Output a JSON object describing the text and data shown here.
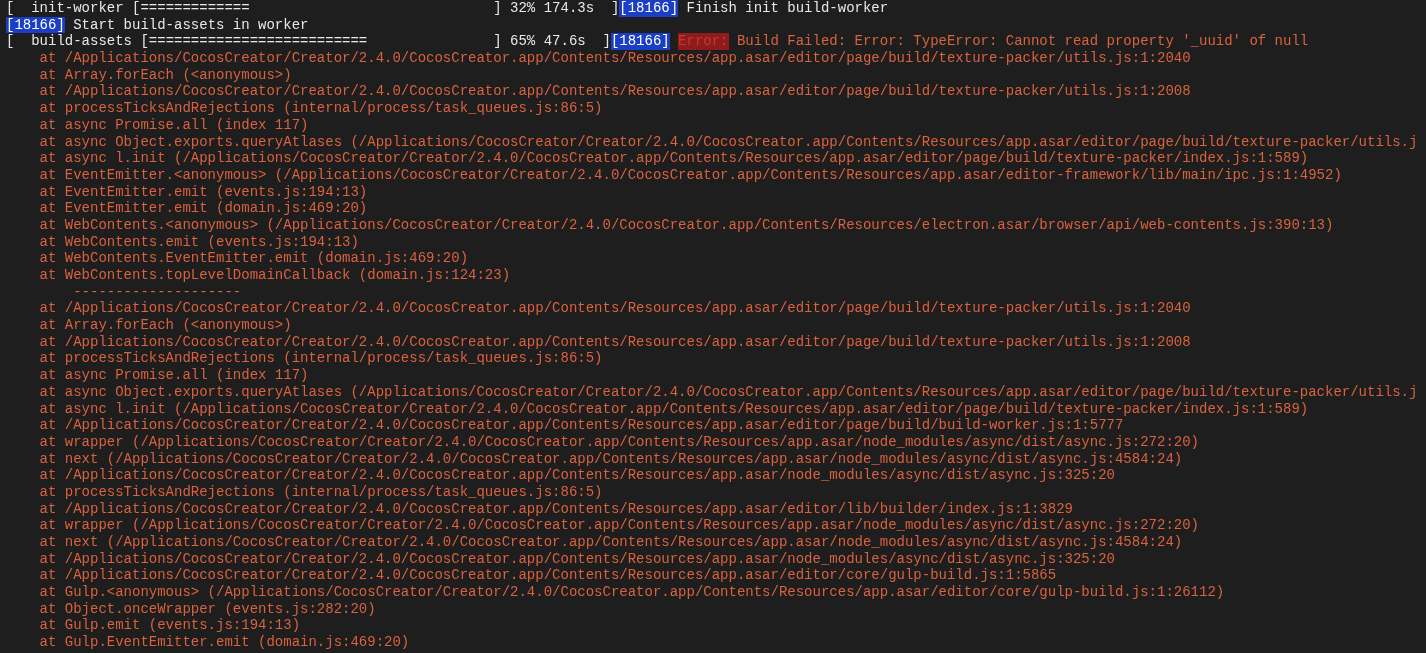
{
  "lines": [
    {
      "kind": "progress",
      "task": "[  init-worker [=============",
      "stats": "] 32% 174.3s  ]",
      "pid": "[18166]",
      "message": "Finish init build-worker"
    },
    {
      "kind": "info",
      "pid": "[18166]",
      "message": "Start build-assets in worker"
    },
    {
      "kind": "progress",
      "task": "[  build-assets [==========================",
      "stats": "] 65% 47.6s  ]",
      "pid": "[18166]",
      "tag": "Error:",
      "message": "Build Failed: Error: TypeError: Cannot read property '_uuid' of null"
    },
    {
      "kind": "trace",
      "text": "at /Applications/CocosCreator/Creator/2.4.0/CocosCreator.app/Contents/Resources/app.asar/editor/page/build/texture-packer/utils.js:1:2040"
    },
    {
      "kind": "trace",
      "text": "at Array.forEach (<anonymous>)"
    },
    {
      "kind": "trace",
      "text": "at /Applications/CocosCreator/Creator/2.4.0/CocosCreator.app/Contents/Resources/app.asar/editor/page/build/texture-packer/utils.js:1:2008"
    },
    {
      "kind": "trace",
      "text": "at processTicksAndRejections (internal/process/task_queues.js:86:5)"
    },
    {
      "kind": "trace",
      "text": "at async Promise.all (index 117)"
    },
    {
      "kind": "trace",
      "text": "at async Object.exports.queryAtlases (/Applications/CocosCreator/Creator/2.4.0/CocosCreator.app/Contents/Resources/app.asar/editor/page/build/texture-packer/utils.j"
    },
    {
      "kind": "trace",
      "text": "at async l.init (/Applications/CocosCreator/Creator/2.4.0/CocosCreator.app/Contents/Resources/app.asar/editor/page/build/texture-packer/index.js:1:589)"
    },
    {
      "kind": "trace",
      "text": "at EventEmitter.<anonymous> (/Applications/CocosCreator/Creator/2.4.0/CocosCreator.app/Contents/Resources/app.asar/editor-framework/lib/main/ipc.js:1:4952)"
    },
    {
      "kind": "trace",
      "text": "at EventEmitter.emit (events.js:194:13)"
    },
    {
      "kind": "trace",
      "text": "at EventEmitter.emit (domain.js:469:20)"
    },
    {
      "kind": "trace",
      "text": "at WebContents.<anonymous> (/Applications/CocosCreator/Creator/2.4.0/CocosCreator.app/Contents/Resources/electron.asar/browser/api/web-contents.js:390:13)"
    },
    {
      "kind": "trace",
      "text": "at WebContents.emit (events.js:194:13)"
    },
    {
      "kind": "trace",
      "text": "at WebContents.EventEmitter.emit (domain.js:469:20)"
    },
    {
      "kind": "trace",
      "text": "at WebContents.topLevelDomainCallback (domain.js:124:23)"
    },
    {
      "kind": "separator",
      "text": "--------------------"
    },
    {
      "kind": "trace",
      "text": "at /Applications/CocosCreator/Creator/2.4.0/CocosCreator.app/Contents/Resources/app.asar/editor/page/build/texture-packer/utils.js:1:2040"
    },
    {
      "kind": "trace",
      "text": "at Array.forEach (<anonymous>)"
    },
    {
      "kind": "trace",
      "text": "at /Applications/CocosCreator/Creator/2.4.0/CocosCreator.app/Contents/Resources/app.asar/editor/page/build/texture-packer/utils.js:1:2008"
    },
    {
      "kind": "trace",
      "text": "at processTicksAndRejections (internal/process/task_queues.js:86:5)"
    },
    {
      "kind": "trace",
      "text": "at async Promise.all (index 117)"
    },
    {
      "kind": "trace",
      "text": "at async Object.exports.queryAtlases (/Applications/CocosCreator/Creator/2.4.0/CocosCreator.app/Contents/Resources/app.asar/editor/page/build/texture-packer/utils.j"
    },
    {
      "kind": "trace",
      "text": "at async l.init (/Applications/CocosCreator/Creator/2.4.0/CocosCreator.app/Contents/Resources/app.asar/editor/page/build/texture-packer/index.js:1:589)"
    },
    {
      "kind": "trace",
      "text": "at /Applications/CocosCreator/Creator/2.4.0/CocosCreator.app/Contents/Resources/app.asar/editor/page/build/build-worker.js:1:5777"
    },
    {
      "kind": "trace",
      "text": "at wrapper (/Applications/CocosCreator/Creator/2.4.0/CocosCreator.app/Contents/Resources/app.asar/node_modules/async/dist/async.js:272:20)"
    },
    {
      "kind": "trace",
      "text": "at next (/Applications/CocosCreator/Creator/2.4.0/CocosCreator.app/Contents/Resources/app.asar/node_modules/async/dist/async.js:4584:24)"
    },
    {
      "kind": "trace",
      "text": "at /Applications/CocosCreator/Creator/2.4.0/CocosCreator.app/Contents/Resources/app.asar/node_modules/async/dist/async.js:325:20"
    },
    {
      "kind": "trace",
      "text": "at processTicksAndRejections (internal/process/task_queues.js:86:5)"
    },
    {
      "kind": "trace",
      "text": "at /Applications/CocosCreator/Creator/2.4.0/CocosCreator.app/Contents/Resources/app.asar/editor/lib/builder/index.js:1:3829"
    },
    {
      "kind": "trace",
      "text": "at wrapper (/Applications/CocosCreator/Creator/2.4.0/CocosCreator.app/Contents/Resources/app.asar/node_modules/async/dist/async.js:272:20)"
    },
    {
      "kind": "trace",
      "text": "at next (/Applications/CocosCreator/Creator/2.4.0/CocosCreator.app/Contents/Resources/app.asar/node_modules/async/dist/async.js:4584:24)"
    },
    {
      "kind": "trace",
      "text": "at /Applications/CocosCreator/Creator/2.4.0/CocosCreator.app/Contents/Resources/app.asar/node_modules/async/dist/async.js:325:20"
    },
    {
      "kind": "trace",
      "text": "at /Applications/CocosCreator/Creator/2.4.0/CocosCreator.app/Contents/Resources/app.asar/editor/core/gulp-build.js:1:5865"
    },
    {
      "kind": "trace",
      "text": "at Gulp.<anonymous> (/Applications/CocosCreator/Creator/2.4.0/CocosCreator.app/Contents/Resources/app.asar/editor/core/gulp-build.js:1:26112)"
    },
    {
      "kind": "trace",
      "text": "at Object.onceWrapper (events.js:282:20)"
    },
    {
      "kind": "trace",
      "text": "at Gulp.emit (events.js:194:13)"
    },
    {
      "kind": "trace",
      "text": "at Gulp.EventEmitter.emit (domain.js:469:20)"
    }
  ]
}
